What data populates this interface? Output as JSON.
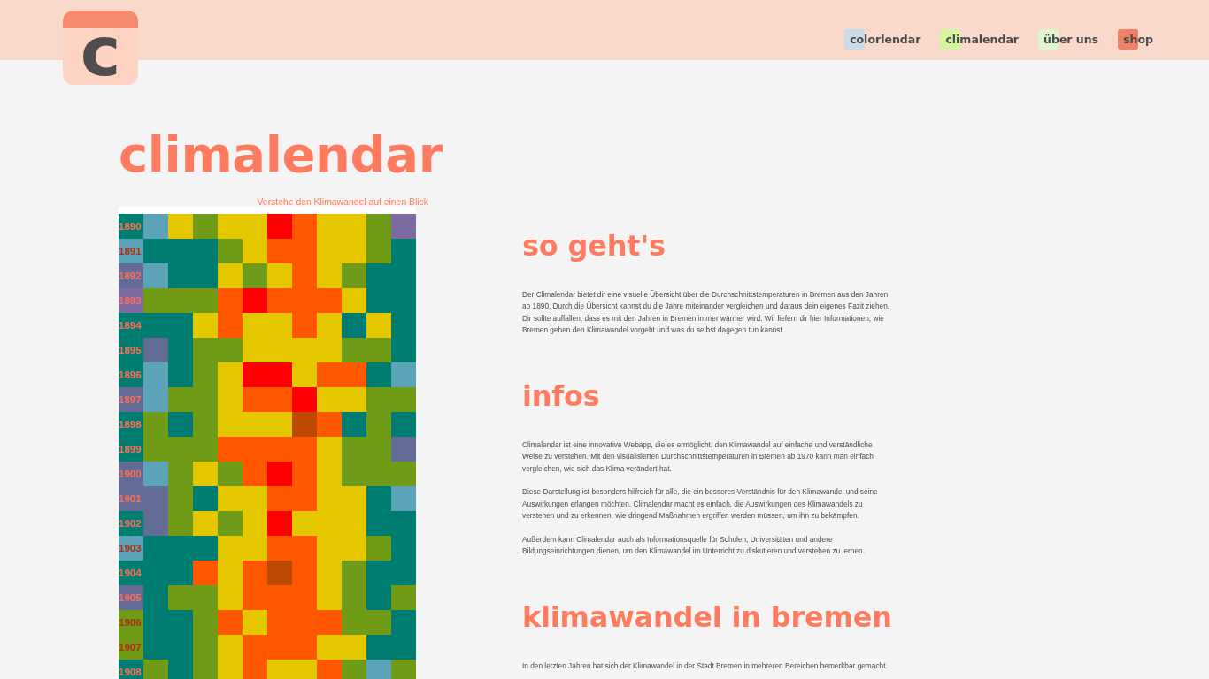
{
  "header": {
    "logo": {
      "letter": "c"
    },
    "nav": [
      {
        "label": "colorlendar",
        "color": "#c9dbe9"
      },
      {
        "label": "climalendar",
        "color": "#d4f59e"
      },
      {
        "label": "über uns",
        "color": "#e0f5cd"
      },
      {
        "label": "shop",
        "color": "#f08068"
      }
    ]
  },
  "page_title": "climalendar",
  "heatmap": {
    "caption": "Verstehe den Klimawandel auf einen Blick",
    "rows": [
      {
        "year": "1890",
        "cells": [
          {
            "color": "#007d71"
          },
          {
            "color": "#5ba3b8"
          },
          {
            "color": "#e5c700"
          },
          {
            "color": "#6f9b16"
          },
          {
            "color": "#e5c700"
          },
          {
            "color": "#e5c700"
          },
          {
            "color": "#ff0000"
          },
          {
            "color": "#ff5800"
          },
          {
            "color": "#e5c700"
          },
          {
            "color": "#e5c700"
          },
          {
            "color": "#6f9b16"
          },
          {
            "color": "#7f6ba4"
          }
        ]
      },
      {
        "year": "1891",
        "cells": [
          {
            "color": "#5ba3b8"
          },
          {
            "color": "#007d71"
          },
          {
            "color": "#007d71"
          },
          {
            "color": "#007d71"
          },
          {
            "color": "#6f9b16"
          },
          {
            "color": "#e5c700"
          },
          {
            "color": "#ff5800"
          },
          {
            "color": "#ff5800"
          },
          {
            "color": "#e5c700"
          },
          {
            "color": "#e5c700"
          },
          {
            "color": "#6f9b16"
          },
          {
            "color": "#007d71"
          }
        ]
      },
      {
        "year": "1892",
        "cells": [
          {
            "color": "#636c96"
          },
          {
            "color": "#5ba3b8"
          },
          {
            "color": "#007d71"
          },
          {
            "color": "#007d71"
          },
          {
            "color": "#e5c700"
          },
          {
            "color": "#6f9b16"
          },
          {
            "color": "#e5c700"
          },
          {
            "color": "#ff5800"
          },
          {
            "color": "#e5c700"
          },
          {
            "color": "#6f9b16"
          },
          {
            "color": "#007d71"
          },
          {
            "color": "#007d71"
          }
        ]
      },
      {
        "year": "1893",
        "cells": [
          {
            "color": "#7f6ba4"
          },
          {
            "color": "#6f9b16"
          },
          {
            "color": "#6f9b16"
          },
          {
            "color": "#6f9b16"
          },
          {
            "color": "#ff5800"
          },
          {
            "color": "#ff0000"
          },
          {
            "color": "#ff5800"
          },
          {
            "color": "#ff5800"
          },
          {
            "color": "#ff5800"
          },
          {
            "color": "#e5c700"
          },
          {
            "color": "#007d71"
          },
          {
            "color": "#007d71"
          }
        ]
      },
      {
        "year": "1894",
        "cells": [
          {
            "color": "#007d71"
          },
          {
            "color": "#007d71"
          },
          {
            "color": "#007d71"
          },
          {
            "color": "#e5c700"
          },
          {
            "color": "#ff5800"
          },
          {
            "color": "#e5c700"
          },
          {
            "color": "#e5c700"
          },
          {
            "color": "#ff5800"
          },
          {
            "color": "#e5c700"
          },
          {
            "color": "#007d71"
          },
          {
            "color": "#e5c700"
          },
          {
            "color": "#007d71"
          }
        ]
      },
      {
        "year": "1895",
        "cells": [
          {
            "color": "#007d71"
          },
          {
            "color": "#636c96"
          },
          {
            "color": "#007d71"
          },
          {
            "color": "#6f9b16"
          },
          {
            "color": "#6f9b16"
          },
          {
            "color": "#e5c700"
          },
          {
            "color": "#e5c700"
          },
          {
            "color": "#e5c700"
          },
          {
            "color": "#e5c700"
          },
          {
            "color": "#6f9b16"
          },
          {
            "color": "#6f9b16"
          },
          {
            "color": "#007d71"
          }
        ]
      },
      {
        "year": "1896",
        "cells": [
          {
            "color": "#007d71"
          },
          {
            "color": "#5ba3b8"
          },
          {
            "color": "#007d71"
          },
          {
            "color": "#6f9b16"
          },
          {
            "color": "#e5c700"
          },
          {
            "color": "#ff0000"
          },
          {
            "color": "#ff0000"
          },
          {
            "color": "#e5c700"
          },
          {
            "color": "#ff5800"
          },
          {
            "color": "#ff5800"
          },
          {
            "color": "#007d71"
          },
          {
            "color": "#5ba3b8"
          }
        ]
      },
      {
        "year": "1897",
        "cells": [
          {
            "color": "#636c96"
          },
          {
            "color": "#5ba3b8"
          },
          {
            "color": "#6f9b16"
          },
          {
            "color": "#6f9b16"
          },
          {
            "color": "#e5c700"
          },
          {
            "color": "#ff5800"
          },
          {
            "color": "#ff5800"
          },
          {
            "color": "#ff0000"
          },
          {
            "color": "#e5c700"
          },
          {
            "color": "#e5c700"
          },
          {
            "color": "#6f9b16"
          },
          {
            "color": "#6f9b16"
          }
        ]
      },
      {
        "year": "1898",
        "cells": [
          {
            "color": "#007d71"
          },
          {
            "color": "#6f9b16"
          },
          {
            "color": "#007d71"
          },
          {
            "color": "#6f9b16"
          },
          {
            "color": "#e5c700"
          },
          {
            "color": "#e5c700"
          },
          {
            "color": "#e5c700"
          },
          {
            "color": "#bd4a00"
          },
          {
            "color": "#ff5800"
          },
          {
            "color": "#007d71"
          },
          {
            "color": "#6f9b16"
          },
          {
            "color": "#007d71"
          }
        ]
      },
      {
        "year": "1899",
        "cells": [
          {
            "color": "#007d71"
          },
          {
            "color": "#6f9b16"
          },
          {
            "color": "#6f9b16"
          },
          {
            "color": "#6f9b16"
          },
          {
            "color": "#ff5800"
          },
          {
            "color": "#ff5800"
          },
          {
            "color": "#ff5800"
          },
          {
            "color": "#ff5800"
          },
          {
            "color": "#e5c700"
          },
          {
            "color": "#6f9b16"
          },
          {
            "color": "#6f9b16"
          },
          {
            "color": "#636c96"
          }
        ]
      },
      {
        "year": "1900",
        "cells": [
          {
            "color": "#636c96"
          },
          {
            "color": "#5ba3b8"
          },
          {
            "color": "#6f9b16"
          },
          {
            "color": "#e5c700"
          },
          {
            "color": "#6f9b16"
          },
          {
            "color": "#ff5800"
          },
          {
            "color": "#ff0000"
          },
          {
            "color": "#ff5800"
          },
          {
            "color": "#e5c700"
          },
          {
            "color": "#6f9b16"
          },
          {
            "color": "#6f9b16"
          },
          {
            "color": "#6f9b16"
          }
        ]
      },
      {
        "year": "1901",
        "cells": [
          {
            "color": "#636c96"
          },
          {
            "color": "#636c96"
          },
          {
            "color": "#6f9b16"
          },
          {
            "color": "#007d71"
          },
          {
            "color": "#e5c700"
          },
          {
            "color": "#e5c700"
          },
          {
            "color": "#ff5800"
          },
          {
            "color": "#ff5800"
          },
          {
            "color": "#e5c700"
          },
          {
            "color": "#e5c700"
          },
          {
            "color": "#007d71"
          },
          {
            "color": "#5ba3b8"
          }
        ]
      },
      {
        "year": "1902",
        "cells": [
          {
            "color": "#007d71"
          },
          {
            "color": "#636c96"
          },
          {
            "color": "#6f9b16"
          },
          {
            "color": "#e5c700"
          },
          {
            "color": "#6f9b16"
          },
          {
            "color": "#e5c700"
          },
          {
            "color": "#ff0000"
          },
          {
            "color": "#e5c700"
          },
          {
            "color": "#e5c700"
          },
          {
            "color": "#e5c700"
          },
          {
            "color": "#007d71"
          },
          {
            "color": "#007d71"
          }
        ]
      },
      {
        "year": "1903",
        "cells": [
          {
            "color": "#5ba3b8"
          },
          {
            "color": "#007d71"
          },
          {
            "color": "#007d71"
          },
          {
            "color": "#007d71"
          },
          {
            "color": "#e5c700"
          },
          {
            "color": "#e5c700"
          },
          {
            "color": "#ff5800"
          },
          {
            "color": "#ff5800"
          },
          {
            "color": "#e5c700"
          },
          {
            "color": "#e5c700"
          },
          {
            "color": "#6f9b16"
          },
          {
            "color": "#007d71"
          }
        ]
      },
      {
        "year": "1904",
        "cells": [
          {
            "color": "#007d71"
          },
          {
            "color": "#007d71"
          },
          {
            "color": "#007d71"
          },
          {
            "color": "#ff5800"
          },
          {
            "color": "#e5c700"
          },
          {
            "color": "#ff5800"
          },
          {
            "color": "#bd4a00"
          },
          {
            "color": "#ff5800"
          },
          {
            "color": "#e5c700"
          },
          {
            "color": "#6f9b16"
          },
          {
            "color": "#007d71"
          },
          {
            "color": "#007d71"
          }
        ]
      },
      {
        "year": "1905",
        "cells": [
          {
            "color": "#636c96"
          },
          {
            "color": "#007d71"
          },
          {
            "color": "#6f9b16"
          },
          {
            "color": "#6f9b16"
          },
          {
            "color": "#e5c700"
          },
          {
            "color": "#ff5800"
          },
          {
            "color": "#ff5800"
          },
          {
            "color": "#ff5800"
          },
          {
            "color": "#e5c700"
          },
          {
            "color": "#6f9b16"
          },
          {
            "color": "#007d71"
          },
          {
            "color": "#6f9b16"
          }
        ]
      },
      {
        "year": "1906",
        "cells": [
          {
            "color": "#6f9b16"
          },
          {
            "color": "#007d71"
          },
          {
            "color": "#007d71"
          },
          {
            "color": "#6f9b16"
          },
          {
            "color": "#ff5800"
          },
          {
            "color": "#e5c700"
          },
          {
            "color": "#ff5800"
          },
          {
            "color": "#ff5800"
          },
          {
            "color": "#ff5800"
          },
          {
            "color": "#6f9b16"
          },
          {
            "color": "#6f9b16"
          },
          {
            "color": "#007d71"
          }
        ]
      },
      {
        "year": "1907",
        "cells": [
          {
            "color": "#6f9b16"
          },
          {
            "color": "#007d71"
          },
          {
            "color": "#007d71"
          },
          {
            "color": "#6f9b16"
          },
          {
            "color": "#e5c700"
          },
          {
            "color": "#ff5800"
          },
          {
            "color": "#ff5800"
          },
          {
            "color": "#ff5800"
          },
          {
            "color": "#e5c700"
          },
          {
            "color": "#e5c700"
          },
          {
            "color": "#007d71"
          },
          {
            "color": "#007d71"
          }
        ]
      },
      {
        "year": "1908",
        "cells": [
          {
            "color": "#007d71"
          },
          {
            "color": "#6f9b16"
          },
          {
            "color": "#007d71"
          },
          {
            "color": "#6f9b16"
          },
          {
            "color": "#e5c700"
          },
          {
            "color": "#ff5800"
          },
          {
            "color": "#e5c700"
          },
          {
            "color": "#e5c700"
          },
          {
            "color": "#ff5800"
          },
          {
            "color": "#6f9b16"
          },
          {
            "color": "#5ba3b8"
          },
          {
            "color": "#6f9b16"
          }
        ]
      }
    ]
  },
  "sections": [
    {
      "heading": "so geht's",
      "paragraphs": [
        "Der Climalendar bietet dir eine visuelle Übersicht über die Durchschnittstemperaturen in Bremen aus den Jahren ab 1890. Durch die Übersicht kannst du die Jahre miteinander vergleichen und daraus dein eigenes Fazit ziehen. Dir sollte auffallen, dass es mit den Jahren in Bremen immer wärmer wird. Wir liefern dir hier Informationen, wie Bremen gehen den Klimawandel vorgeht und was du selbst dagegen tun kannst."
      ]
    },
    {
      "heading": "infos",
      "paragraphs": [
        "Climalendar ist eine innovative Webapp, die es ermöglicht, den Klimawandel auf einfache und verständliche Weise zu verstehen. Mit den visualisierten Durchschnittstemperaturen in Bremen ab 1970 kann man einfach vergleichen, wie sich das Klima verändert hat.",
        "Diese Darstellung ist besonders hilfreich für alle, die ein besseres Verständnis für den Klimawandel und seine Auswirkungen erlangen möchten. Climalendar macht es einfach, die Auswirkungen des Klimawandels zu verstehen und zu erkennen, wie dringend Maßnahmen ergriffen werden müssen, um ihn zu bekämpfen.",
        "Außerdem kann Climalendar auch als Informationsquelle für Schulen, Universitäten und andere Bildungseinrichtungen dienen, um den Klimawandel im Unterricht zu diskutieren und verstehen zu lernen."
      ]
    },
    {
      "heading": "klimawandel in bremen",
      "paragraphs": [
        "In den letzten Jahren hat sich der Klimawandel in der Stadt Bremen in mehreren Bereichen bemerkbar gemacht."
      ]
    }
  ]
}
